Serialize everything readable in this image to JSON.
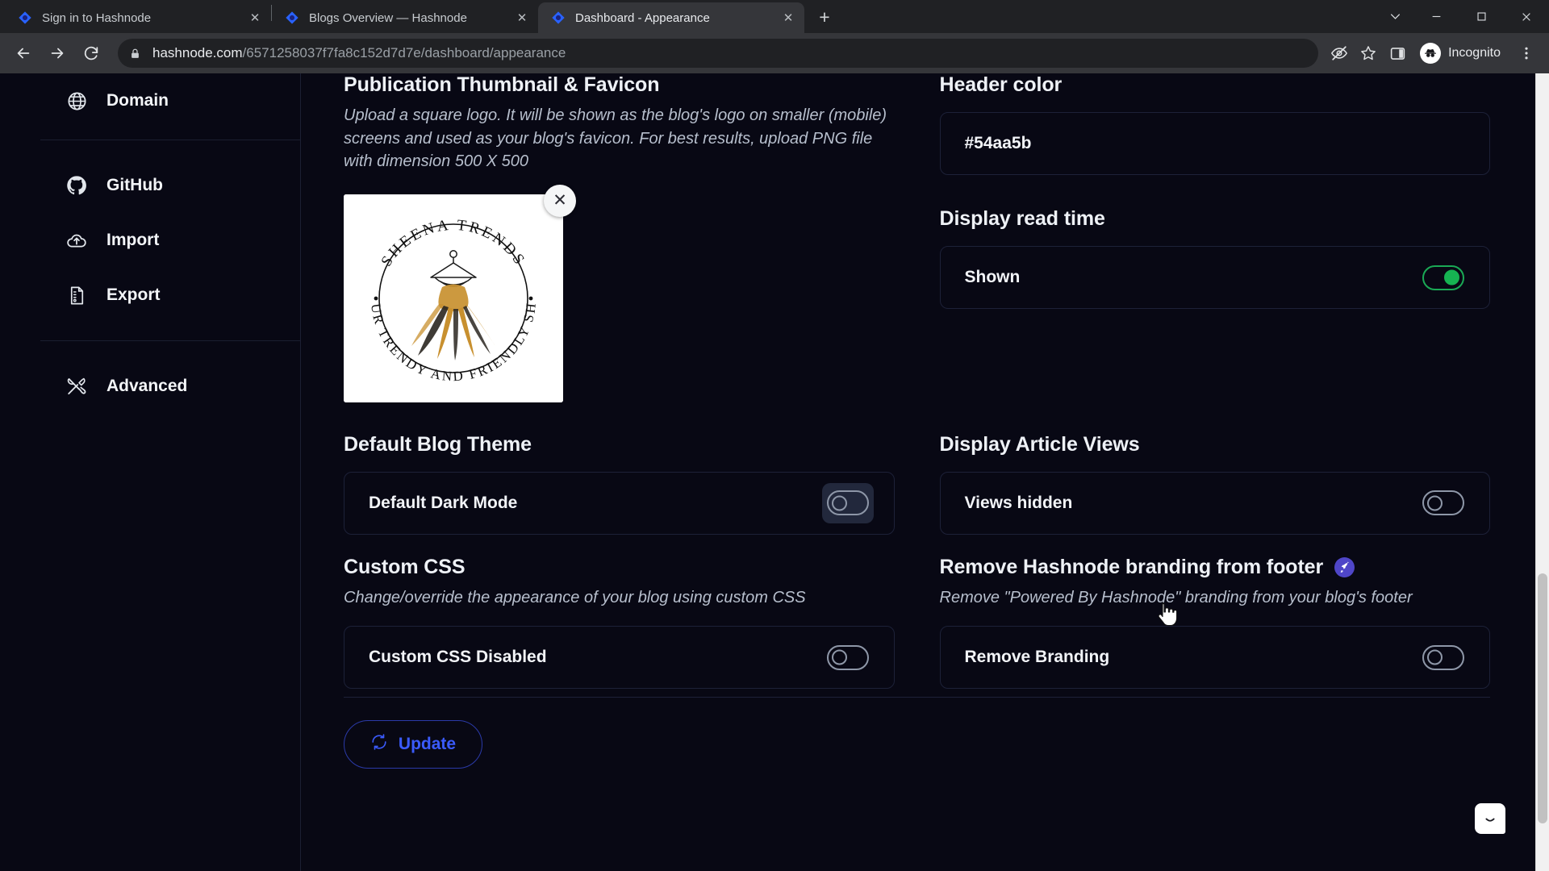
{
  "browser": {
    "tabs": [
      {
        "title": "Sign in to Hashnode",
        "active": false
      },
      {
        "title": "Blogs Overview — Hashnode",
        "active": false
      },
      {
        "title": "Dashboard - Appearance",
        "active": true
      }
    ],
    "new_tab_label": "+",
    "close_label": "✕",
    "window_controls": {
      "chevron": "⌄",
      "minimize": "—",
      "maximize": "▢",
      "close": "✕"
    },
    "nav": {
      "back": "back-arrow",
      "forward": "forward-arrow",
      "reload": "reload-arrow"
    },
    "omnibox": {
      "lock_icon": "lock-icon",
      "domain": "hashnode.com",
      "path": "/6571258037f7fa8c152d7d7e/dashboard/appearance"
    },
    "toolbar_icons": [
      "eye-off-icon",
      "star-icon",
      "side-panel-icon",
      "kebab-menu-icon"
    ],
    "profile": {
      "label": "Incognito",
      "icon": "incognito-icon"
    }
  },
  "sidebar": {
    "groups": [
      {
        "items": [
          {
            "label": "Domain",
            "icon": "globe-icon"
          }
        ]
      },
      {
        "items": [
          {
            "label": "GitHub",
            "icon": "github-icon"
          },
          {
            "label": "Import",
            "icon": "cloud-upload-icon"
          },
          {
            "label": "Export",
            "icon": "document-icon"
          }
        ]
      },
      {
        "items": [
          {
            "label": "Advanced",
            "icon": "tools-icon"
          }
        ]
      }
    ]
  },
  "main": {
    "thumbnail_section": {
      "title": "Publication Thumbnail & Favicon",
      "description": "Upload a square logo. It will be shown as the blog's logo on smaller (mobile) screens and used as your blog's favicon. For best results, upload PNG file with dimension 500 X 500",
      "remove_label": "✕",
      "logo": {
        "brand_top": "SHEENA TRENDS",
        "brand_bottom": "YOUR TRENDY AND FRIENDLY SHOP"
      }
    },
    "header_color_section": {
      "title": "Header color",
      "value": "#54aa5b"
    },
    "read_time_section": {
      "title": "Display read time",
      "state_label": "Shown",
      "toggle_on": true
    },
    "blog_theme_section": {
      "title": "Default Blog Theme",
      "state_label": "Default Dark Mode",
      "toggle_on": false
    },
    "article_views_section": {
      "title": "Display Article Views",
      "state_label": "Views hidden",
      "toggle_on": false
    },
    "custom_css_section": {
      "title": "Custom CSS",
      "description": "Change/override the appearance of your blog using custom CSS",
      "state_label": "Custom CSS Disabled",
      "toggle_on": false
    },
    "remove_branding_section": {
      "title": "Remove Hashnode branding from footer",
      "badge_icon": "rocket-icon",
      "description": "Remove \"Powered By Hashnode\" branding from your blog's footer",
      "state_label": "Remove Branding",
      "toggle_on": false
    },
    "update_button": {
      "label": "Update",
      "icon": "refresh-icon"
    }
  },
  "widgets": {
    "chat": "chat-bubble-icon"
  },
  "colors": {
    "page_bg": "#080814",
    "accent_blue": "#3b5bfd",
    "toggle_on_green": "#16b352",
    "pro_purple": "#4f46c8",
    "header_color_value": "#54aa5b"
  }
}
